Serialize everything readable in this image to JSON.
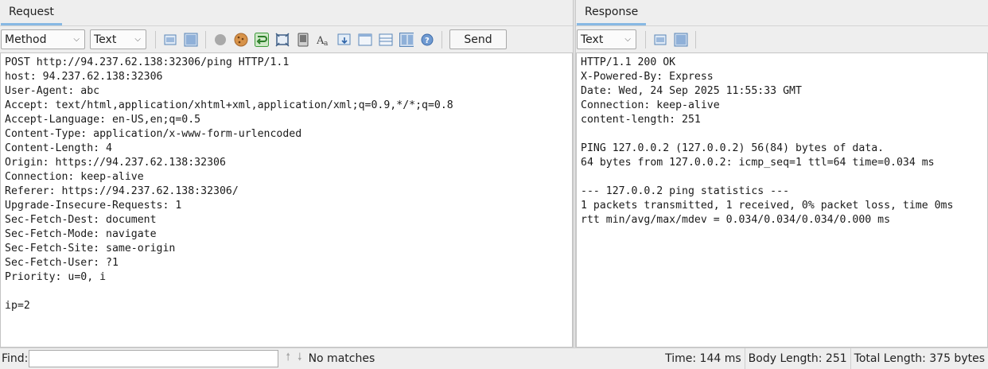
{
  "request": {
    "tab_label": "Request",
    "method_select": "Method",
    "format_select": "Text",
    "send_label": "Send",
    "lines": [
      "POST http://94.237.62.138:32306/ping HTTP/1.1",
      "host: 94.237.62.138:32306",
      "User-Agent: abc",
      "Accept: text/html,application/xhtml+xml,application/xml;q=0.9,*/*;q=0.8",
      "Accept-Language: en-US,en;q=0.5",
      "Content-Type: application/x-www-form-urlencoded",
      "Content-Length: 4",
      "Origin: https://94.237.62.138:32306",
      "Connection: keep-alive",
      "Referer: https://94.237.62.138:32306/",
      "Upgrade-Insecure-Requests: 1",
      "Sec-Fetch-Dest: document",
      "Sec-Fetch-Mode: navigate",
      "Sec-Fetch-Site: same-origin",
      "Sec-Fetch-User: ?1",
      "Priority: u=0, i",
      "",
      "ip=2"
    ]
  },
  "response": {
    "tab_label": "Response",
    "format_select": "Text",
    "lines": [
      "HTTP/1.1 200 OK",
      "X-Powered-By: Express",
      "Date: Wed, 24 Sep 2025 11:55:33 GMT",
      "Connection: keep-alive",
      "content-length: 251",
      "",
      "PING 127.0.0.2 (127.0.0.2) 56(84) bytes of data.",
      "64 bytes from 127.0.0.2: icmp_seq=1 ttl=64 time=0.034 ms",
      "",
      "--- 127.0.0.2 ping statistics ---",
      "1 packets transmitted, 1 received, 0% packet loss, time 0ms",
      "rtt min/avg/max/mdev = 0.034/0.034/0.034/0.000 ms"
    ]
  },
  "status": {
    "find_label": "Find:",
    "find_value": "",
    "no_matches": "No matches",
    "time": "Time: 144 ms",
    "body_length": "Body Length: 251",
    "total_length": "Total Length: 375 bytes"
  },
  "icons": {
    "request_toolbar": [
      "layout-horizontal-icon",
      "layout-vertical-icon",
      "grey-circle-icon",
      "cookie-icon",
      "follow-redirect-icon",
      "resize-icon",
      "device-icon",
      "font-icon",
      "save-icon",
      "browser-window-icon",
      "table-icon",
      "split-view-icon",
      "help-icon"
    ],
    "response_toolbar": [
      "layout-horizontal-icon",
      "layout-vertical-icon"
    ]
  },
  "colors": {
    "tab_underline": "#87b8e3",
    "icon_blue": "#5b87b8",
    "cookie": "#d7934a",
    "redirect_green": "#3c9a3a"
  }
}
